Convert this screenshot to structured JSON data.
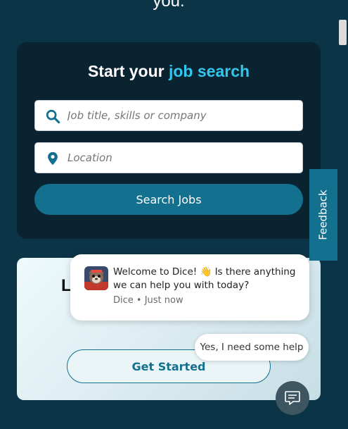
{
  "hero": {
    "tail_text": "you."
  },
  "search": {
    "title_part1": "Start your ",
    "title_part2": "job search",
    "job_placeholder": "Job title, skills or company",
    "location_placeholder": "Location",
    "button_label": "Search Jobs"
  },
  "promo": {
    "heading_initial": "L",
    "button_label": "Get Started"
  },
  "feedback": {
    "label": "Feedback"
  },
  "chat": {
    "message": "Welcome to Dice! 👋 Is there anything we can help you with today?",
    "meta": "Dice • Just now",
    "quick_reply": "Yes, I need some help"
  },
  "colors": {
    "background": "#0c3447",
    "card": "#0a2331",
    "accent": "#33c6ec",
    "primary": "#13708e"
  },
  "icons": [
    "search-icon",
    "location-pin-icon",
    "chat-icon",
    "dice-mascot-avatar"
  ]
}
